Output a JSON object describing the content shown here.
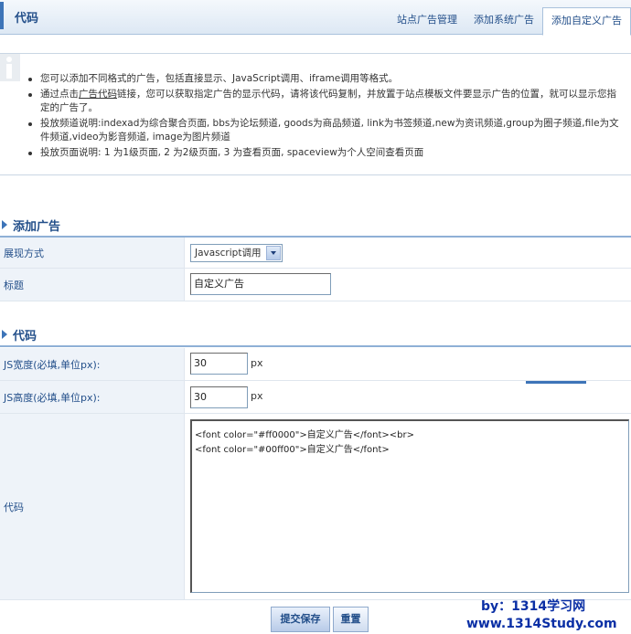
{
  "header": {
    "title": "代码",
    "tabs": [
      "站点广告管理",
      "添加系统广告",
      "添加自定义广告"
    ]
  },
  "info": {
    "items": [
      "您可以添加不同格式的广告，包括直接显示、JavaScript调用、iframe调用等格式。",
      "通过点击",
      "广告代码",
      "链接，您可以获取指定广告的显示代码，请将该代码复制，并放置于站点模板文件要显示广告的位置，就可以显示您指定的广告了。",
      "投放频道说明:indexad为综合聚合页面, bbs为论坛频道, goods为商品频道, link为书签频道,new为资讯频道,group为圈子频道,file为文件频道,video为影音频道, image为图片频道",
      "投放页面说明: 1 为1级页面, 2 为2级页面, 3 为查看页面, spaceview为个人空间查看页面"
    ]
  },
  "section_add": {
    "title": "添加广告"
  },
  "display_mode": {
    "label": "展现方式",
    "value": "Javascript调用"
  },
  "title_field": {
    "label": "标题",
    "value": "自定义广告"
  },
  "section_code": {
    "title": "代码"
  },
  "js_width": {
    "label": "JS宽度(必填,单位px):",
    "value": "30",
    "unit": "px"
  },
  "js_height": {
    "label": "JS高度(必填,单位px):",
    "value": "30",
    "unit": "px"
  },
  "code_field": {
    "label": "代码",
    "value": "<font color=\"#ff0000\">自定义广告</font><br>\n<font color=\"#00ff00\">自定义广告</font>"
  },
  "buttons": {
    "submit": "提交保存",
    "reset": "重置"
  },
  "watermark": {
    "line1": "by：1314学习网",
    "line2": "www.1314Study.com"
  },
  "colors": {
    "accent": "#3d74b8",
    "title": "#234f8a",
    "watermark": "#0a2fa5"
  }
}
